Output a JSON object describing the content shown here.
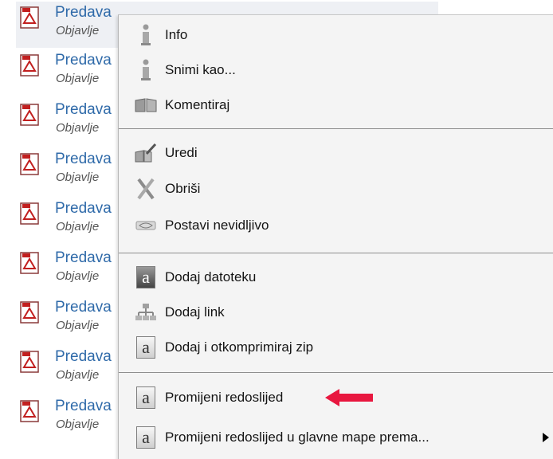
{
  "file_list": {
    "items": [
      {
        "name": "Predava",
        "meta": "Objavlje"
      },
      {
        "name": "Predava",
        "meta": "Objavlje"
      },
      {
        "name": "Predava",
        "meta": "Objavlje"
      },
      {
        "name": "Predava",
        "meta": "Objavlje"
      },
      {
        "name": "Predava",
        "meta": "Objavlje"
      },
      {
        "name": "Predava",
        "meta": "Objavlje"
      },
      {
        "name": "Predava",
        "meta": "Objavlje"
      },
      {
        "name": "Predava",
        "meta": "Objavlje"
      },
      {
        "name": "Predava",
        "meta": "Objavlje"
      }
    ]
  },
  "context_menu": {
    "items": [
      {
        "label": "Info",
        "icon": "info-icon"
      },
      {
        "label": "Snimi kao...",
        "icon": "info-icon"
      },
      {
        "label": "Komentiraj",
        "icon": "book-icon"
      },
      {
        "label": "Uredi",
        "icon": "edit-icon"
      },
      {
        "label": "Obriši",
        "icon": "delete-icon"
      },
      {
        "label": "Postavi nevidljivo",
        "icon": "hidden-icon"
      },
      {
        "label": "Dodaj datoteku",
        "icon": "letter-a-icon"
      },
      {
        "label": "Dodaj link",
        "icon": "link-icon"
      },
      {
        "label": "Dodaj i otkomprimiraj zip",
        "icon": "letter-a-icon"
      },
      {
        "label": "Promijeni redoslijed",
        "icon": "letter-a-icon"
      },
      {
        "label": "Promijeni redoslijed u glavne mape prema...",
        "icon": "letter-a-icon",
        "has_submenu": true
      }
    ]
  },
  "colors": {
    "link_blue": "#2f6aa9",
    "annotation_red": "#e8173f"
  }
}
